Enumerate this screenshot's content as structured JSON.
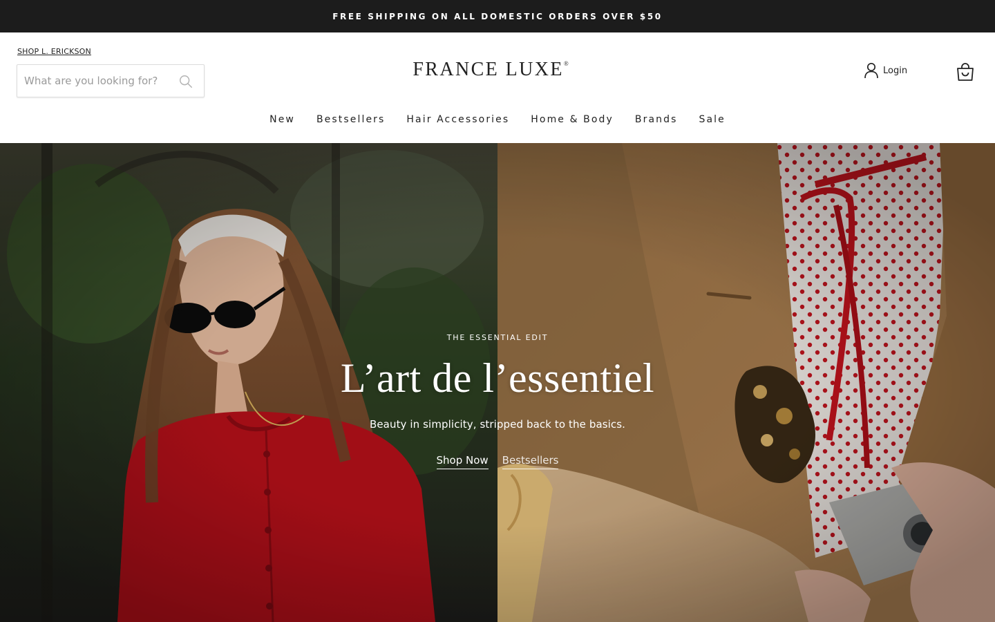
{
  "announcement": {
    "text": "FREE SHIPPING ON ALL DOMESTIC ORDERS OVER $50"
  },
  "header": {
    "shop_link": "SHOP L. ERICKSON",
    "search": {
      "placeholder": "What are you looking for?",
      "value": ""
    },
    "logo": {
      "text": "FRANCE LUXE",
      "mark": "®"
    },
    "login_label": "Login",
    "icons": {
      "search": "search-icon",
      "account": "user-icon",
      "cart": "shopping-bag-icon"
    }
  },
  "nav": {
    "items": [
      {
        "label": "New"
      },
      {
        "label": "Bestsellers"
      },
      {
        "label": "Hair Accessories"
      },
      {
        "label": "Home & Body"
      },
      {
        "label": "Brands"
      },
      {
        "label": "Sale"
      }
    ]
  },
  "hero": {
    "eyebrow": "THE ESSENTIAL EDIT",
    "headline": "L’art de l’essentiel",
    "subline": "Beauty in simplicity, stripped back to the basics.",
    "primary_cta": "Shop Now",
    "secondary_cta": "Bestsellers"
  },
  "colors": {
    "announcement_bg": "#1c1c1c",
    "text": "#222222",
    "hero_red": "#b8101a",
    "coat_tan": "#a77c4a"
  }
}
